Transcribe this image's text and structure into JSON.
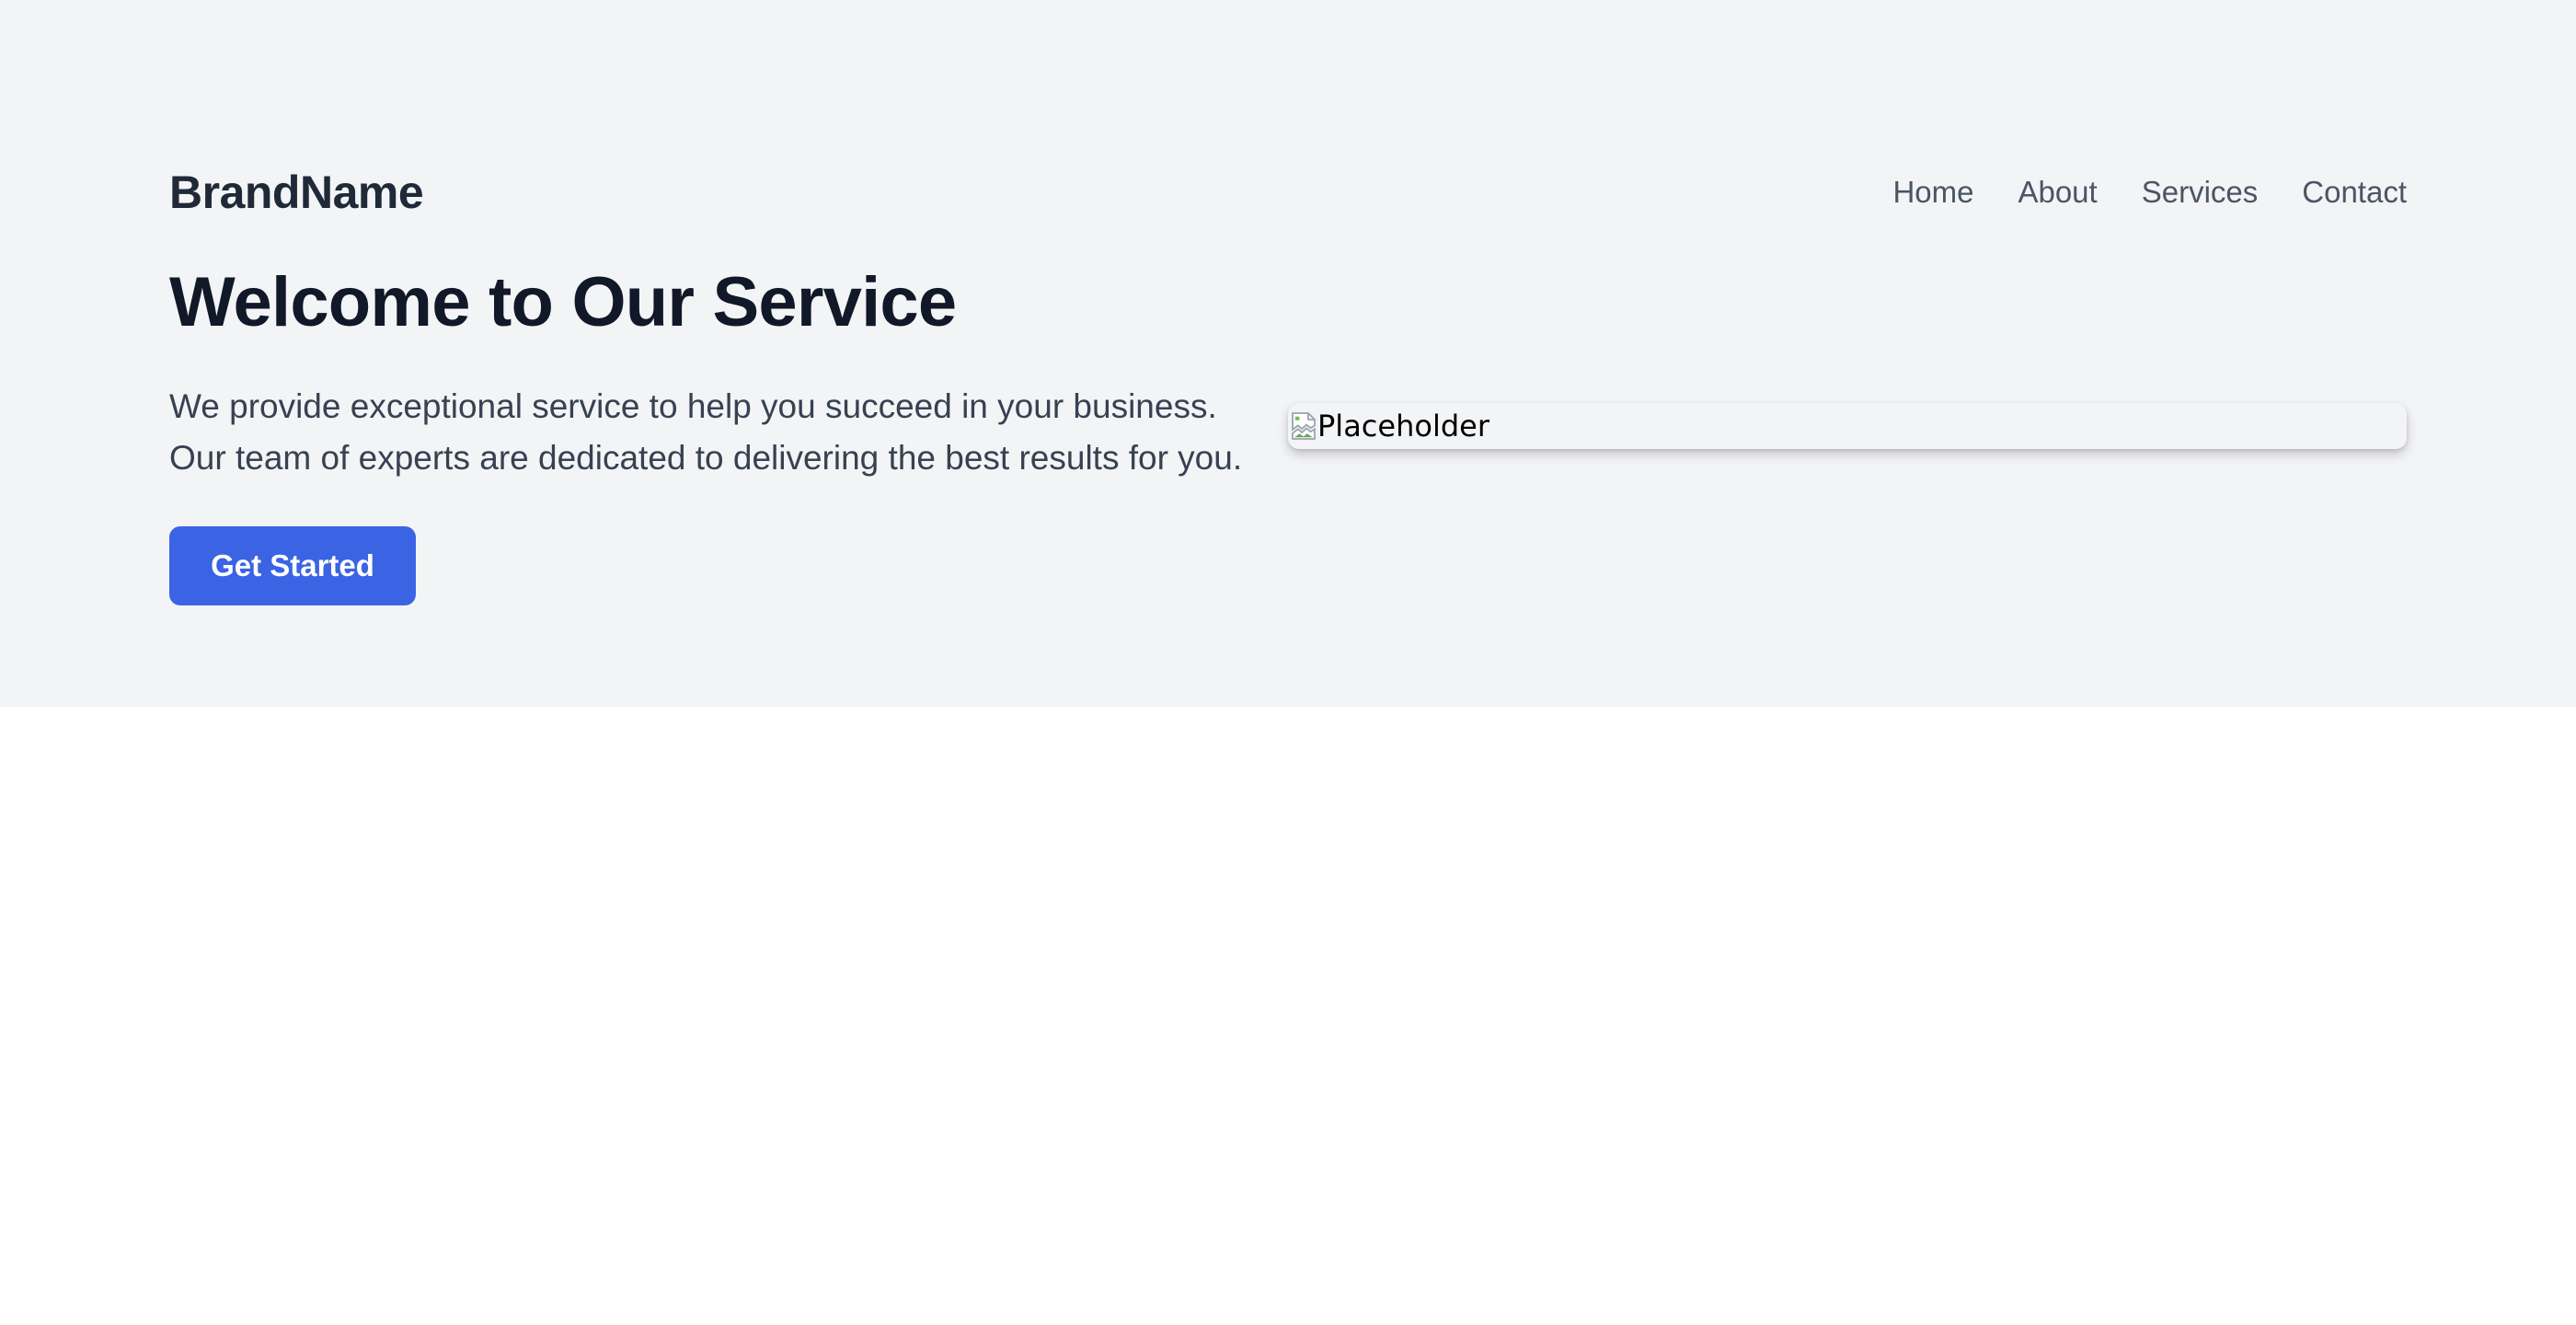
{
  "brand": {
    "name": "BrandName"
  },
  "nav": {
    "items": [
      {
        "label": "Home"
      },
      {
        "label": "About"
      },
      {
        "label": "Services"
      },
      {
        "label": "Contact"
      }
    ]
  },
  "hero": {
    "title": "Welcome to Our Service",
    "description": "We provide exceptional service to help you succeed in your business. Our team of experts are dedicated to delivering the best results for you.",
    "cta_label": "Get Started",
    "image_alt": "Placeholder"
  },
  "colors": {
    "hero_background": "#f3f4f6",
    "page_background": "#ffffff",
    "primary_button": "#3b64e4",
    "heading": "#111827",
    "body_text": "#374151",
    "nav_text": "#4b5563"
  },
  "icons": {
    "image": "broken-image-icon"
  }
}
